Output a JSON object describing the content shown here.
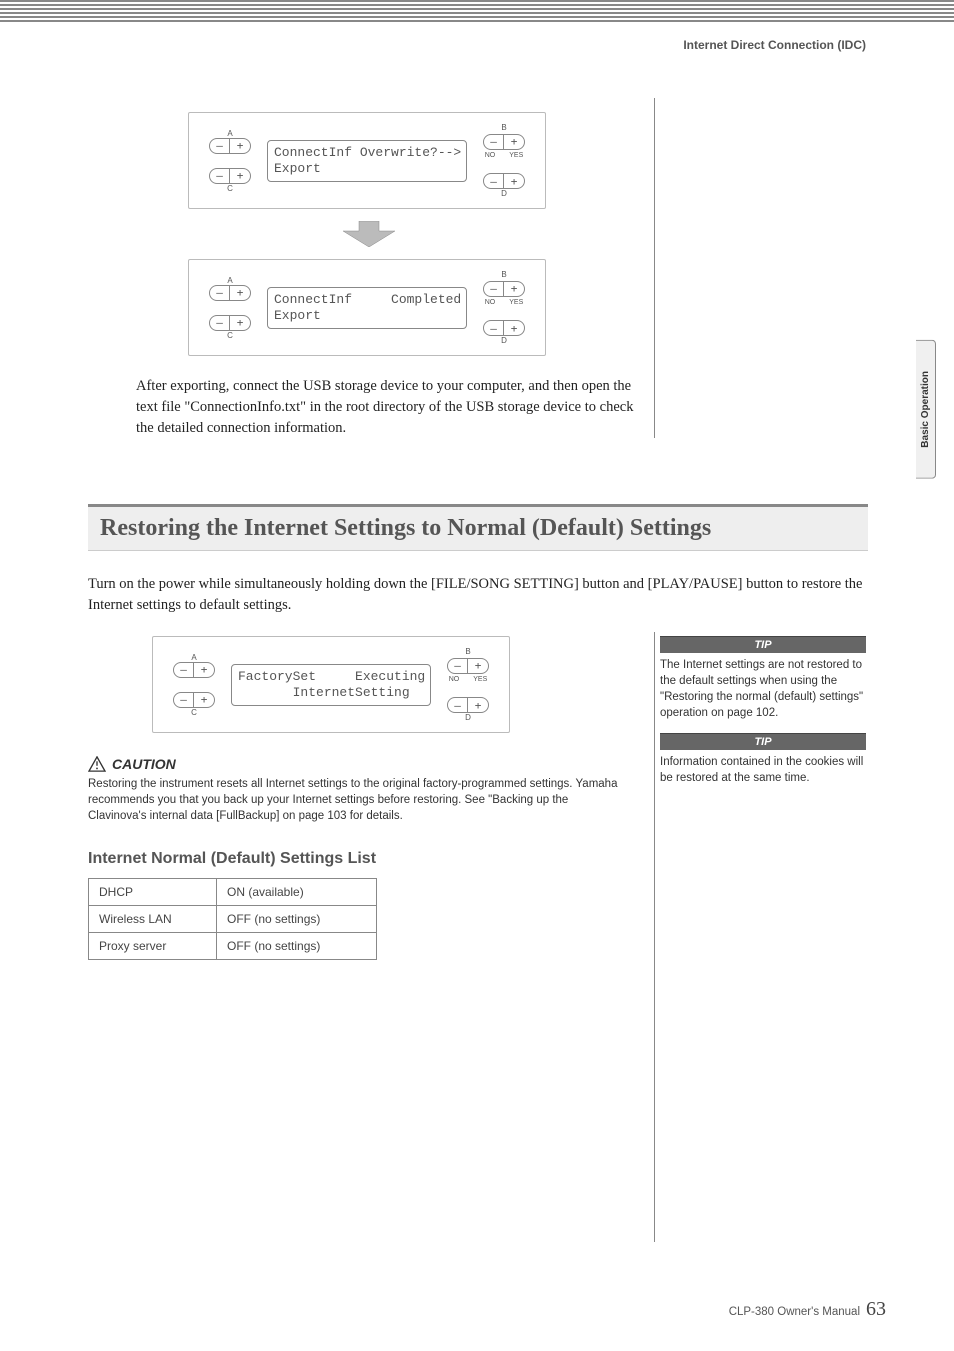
{
  "header": {
    "section_title": "Internet Direct Connection (IDC)"
  },
  "side_tab": "Basic Operation",
  "lcd1": {
    "a": "A",
    "b": "B",
    "c": "C",
    "d": "D",
    "no": "NO",
    "yes": "YES",
    "line1": "ConnectInf Overwrite?-->",
    "line2": "Export"
  },
  "lcd2": {
    "a": "A",
    "b": "B",
    "c": "C",
    "d": "D",
    "no": "NO",
    "yes": "YES",
    "line1": "ConnectInf     Completed",
    "line2": "Export"
  },
  "export_paragraph": "After exporting, connect the USB storage device to your computer, and then open the text file \"ConnectionInfo.txt\" in the root directory of the USB storage device to check the detailed connection information.",
  "section_heading": "Restoring the Internet Settings to Normal (Default) Settings",
  "restore_paragraph": "Turn on the power while simultaneously holding down the [FILE/SONG SETTING] button and [PLAY/PAUSE] button to restore the Internet settings to default settings.",
  "lcd3": {
    "a": "A",
    "b": "B",
    "c": "C",
    "d": "D",
    "no": "NO",
    "yes": "YES",
    "line1": "FactorySet     Executing",
    "line2": "       InternetSetting"
  },
  "caution": {
    "label": "CAUTION",
    "text": "Restoring the instrument resets all Internet settings to the original factory-programmed settings. Yamaha recommends you that you back up your Internet settings before restoring. See \"Backing up the Clavinova's internal data [FullBackup] on page 103 for details."
  },
  "defaults_heading": "Internet Normal (Default) Settings List",
  "defaults_table": [
    {
      "name": "DHCP",
      "value": "ON (available)"
    },
    {
      "name": "Wireless LAN",
      "value": "OFF (no settings)"
    },
    {
      "name": "Proxy server",
      "value": "OFF (no settings)"
    }
  ],
  "tips": {
    "label": "TIP",
    "tip1": "The Internet settings are not restored to the default settings when using the \"Restoring the normal (default) settings\" operation on page 102.",
    "tip2": "Information contained in the cookies will be restored at the same time."
  },
  "footer": {
    "manual": "CLP-380 Owner's Manual",
    "page": "63"
  },
  "glyph": {
    "minus": "–",
    "plus": "+"
  }
}
